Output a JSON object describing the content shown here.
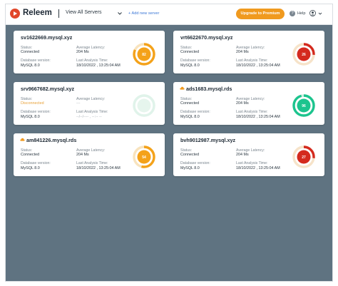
{
  "topbar": {
    "brand": "Releem",
    "server_selector": "View All Servers",
    "add_server": "+ Add new server",
    "upgrade_button": "Upgrade to Premium",
    "help": "Help"
  },
  "colors": {
    "background": "#5f7381",
    "accent_orange": "#f09a1f",
    "gauge_red": "#d42a1e",
    "gauge_green": "#1cc48e",
    "status_disconnected": "#e8a23a",
    "link_blue": "#3b77d6"
  },
  "labels": {
    "status": "Status:",
    "db_version": "Database version:",
    "avg_latency": "Average Latency:",
    "last_analysis": "Last Analysis Time:"
  },
  "cards": [
    {
      "name": "sv1622669.mysql.xyz",
      "icon": "",
      "status": "Connected",
      "db_version": "MySQL 8.0",
      "latency": "204 Ms",
      "analysis_time": "18/10/2022 , 13:25:04 AM",
      "score": "82",
      "gauge_level": 0.82,
      "gauge_color": "#f4a21a",
      "gauge_track": "#f8e3bd"
    },
    {
      "name": "vrt6622670.mysql.xyz",
      "icon": "",
      "status": "Connected",
      "db_version": "MySQL 8.0",
      "latency": "204 Ms",
      "analysis_time": "18/10/2022 , 13:25:04 AM",
      "score": "26",
      "gauge_level": 0.26,
      "gauge_color": "#d42a1e",
      "gauge_track": "#f6e3c9"
    },
    {
      "name": "srv9667682.mysql.xyz",
      "icon": "",
      "status": "Disconnected",
      "db_version": "MySQL 8.0",
      "latency": "---",
      "analysis_time": "--/--/---- , --:-- --",
      "score": "",
      "gauge_level": 1.0,
      "gauge_color": "#e0f3ea",
      "gauge_track": "#eef7f2"
    },
    {
      "name": "ads1683.mysql.rds",
      "icon": "cloud-icon",
      "status": "Connected",
      "db_version": "MySQL 8.0",
      "latency": "204 Ms",
      "analysis_time": "18/10/2022 , 13:25:04 AM",
      "score": "96",
      "gauge_level": 0.96,
      "gauge_color": "#1cc48e",
      "gauge_track": "#cdeedf"
    },
    {
      "name": "am841226.mysql.rds",
      "icon": "cloud-icon",
      "status": "Connected",
      "db_version": "MySQL 8.0",
      "latency": "204 Ms",
      "analysis_time": "18/10/2022 , 13:25:04 AM",
      "score": "54",
      "gauge_level": 0.54,
      "gauge_color": "#f4a21a",
      "gauge_track": "#f8e3bd"
    },
    {
      "name": "bvh9012987.mysql.xyz",
      "icon": "",
      "status": "Connected",
      "db_version": "MySQL 8.0",
      "latency": "204 Ms",
      "analysis_time": "18/10/2022 , 13:25:04 AM",
      "score": "27",
      "gauge_level": 0.27,
      "gauge_color": "#d42a1e",
      "gauge_track": "#f6e3c9"
    }
  ]
}
